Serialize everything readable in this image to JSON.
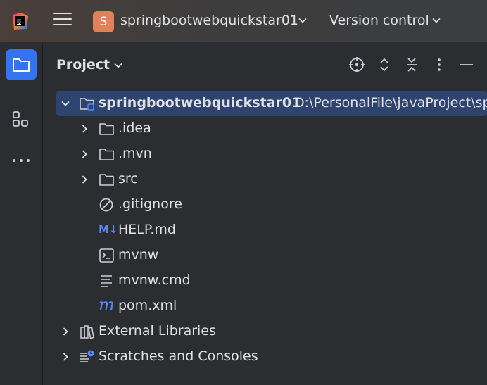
{
  "colors": {
    "accent": "#3574f0",
    "selection": "#2e436e",
    "badge": "#e0815a",
    "background": "#2b2d30"
  },
  "titlebar": {
    "app_icon": "intellij-idea-logo",
    "menu_icon": "hamburger-menu-icon",
    "project_badge": "S",
    "project_name": "springbootwebquickstar01",
    "version_control": "Version control"
  },
  "toolstrip": {
    "items": [
      {
        "icon": "folder-icon",
        "active": true
      },
      {
        "icon": "structure-icon",
        "active": false
      },
      {
        "icon": "more-icon",
        "active": false
      }
    ]
  },
  "panel": {
    "title": "Project",
    "header_icons": [
      "locate-icon",
      "expand-all-icon",
      "collapse-all-icon",
      "options-icon",
      "hide-icon"
    ]
  },
  "tree": {
    "root": {
      "name": "springbootwebquickstar01",
      "path": "D:\\PersonalFile\\javaProject\\sp"
    },
    "children": [
      {
        "name": ".idea",
        "icon": "folder-icon"
      },
      {
        "name": ".mvn",
        "icon": "folder-icon"
      },
      {
        "name": "src",
        "icon": "folder-icon"
      },
      {
        "name": ".gitignore",
        "icon": "ignored-file-icon"
      },
      {
        "name": "HELP.md",
        "icon": "markdown-icon",
        "icon_text": "M↓"
      },
      {
        "name": "mvnw",
        "icon": "shell-script-icon"
      },
      {
        "name": "mvnw.cmd",
        "icon": "text-file-icon"
      },
      {
        "name": "pom.xml",
        "icon": "maven-icon",
        "icon_text": "m"
      }
    ],
    "external_libraries": "External Libraries",
    "scratches": "Scratches and Consoles"
  }
}
